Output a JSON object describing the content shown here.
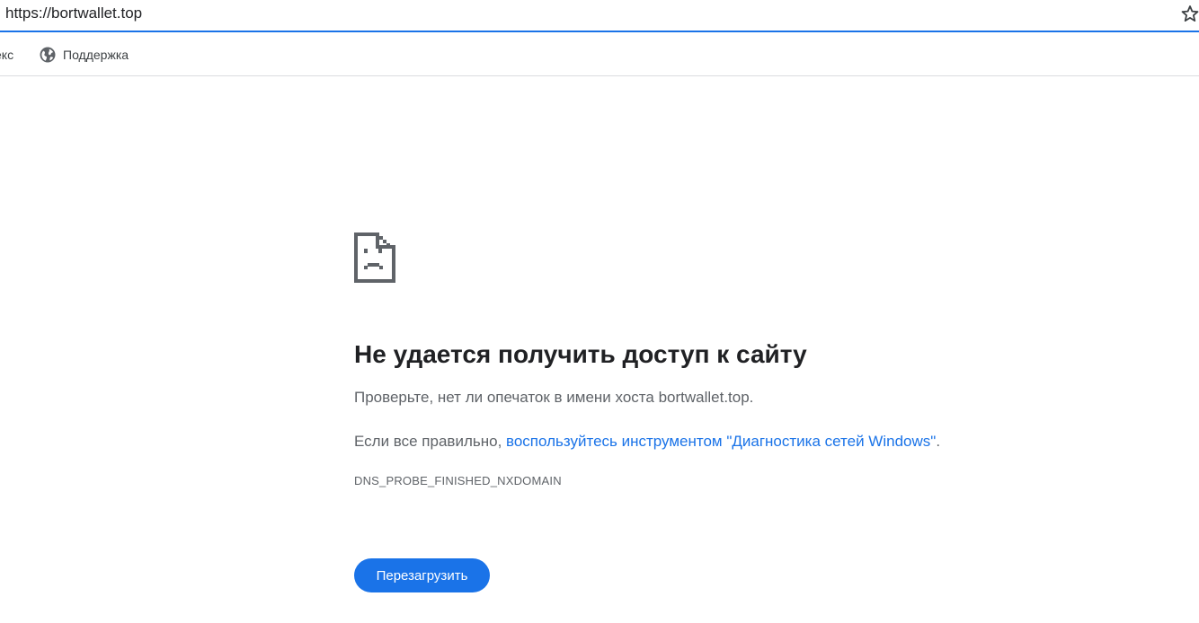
{
  "address_bar": {
    "url": "https://bortwallet.top",
    "star_icon": "star-outline-icon"
  },
  "bookmarks": [
    {
      "label": "екс",
      "icon": ""
    },
    {
      "label": "Поддержка",
      "icon": "globe-icon"
    }
  ],
  "error_page": {
    "icon": "sad-page-icon",
    "title": "Не удается получить доступ к сайту",
    "suggestion_1": "Проверьте, нет ли опечаток в имени хоста bortwallet.top.",
    "suggestion_2_prefix": "Если все правильно, ",
    "suggestion_2_link": "воспользуйтесь инструментом \"Диагностика сетей Windows\"",
    "suggestion_2_suffix": ".",
    "error_code": "DNS_PROBE_FINISHED_NXDOMAIN",
    "reload_label": "Перезагрузить"
  },
  "colors": {
    "accent": "#1a73e8",
    "text_primary": "#202124",
    "text_secondary": "#5f6368",
    "icon_gray": "#5f6368"
  }
}
